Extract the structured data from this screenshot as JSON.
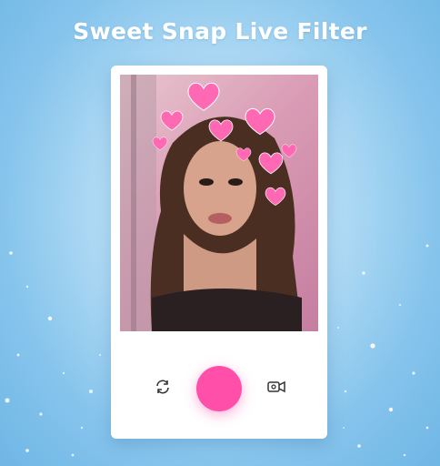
{
  "header": {
    "title": "Sweet Snap Live Filter"
  },
  "camera": {
    "switch_icon": "camera-switch-icon",
    "shutter_icon": "shutter-button",
    "video_icon": "video-record-icon"
  },
  "colors": {
    "background": "#9ccff0",
    "shutter": "#ff4fa8",
    "hearts": "#ff69b4",
    "card": "#ffffff"
  }
}
